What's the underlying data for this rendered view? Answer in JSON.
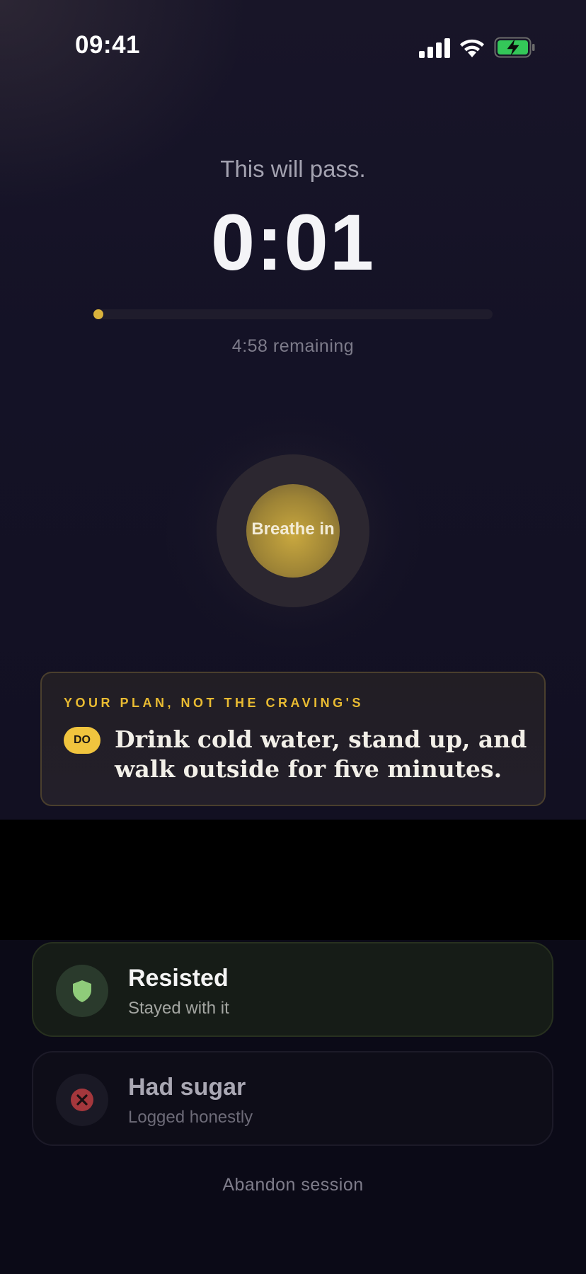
{
  "status_bar": {
    "time": "09:41",
    "icons": [
      "signal-icon",
      "wifi-icon",
      "battery-charging-icon"
    ],
    "battery_color": "#34c759"
  },
  "session": {
    "subtitle": "This will pass.",
    "timer": "0:01",
    "progress_fraction": 0.003,
    "remaining": "4:58 remaining",
    "accent_color": "#d9b23c"
  },
  "breathing": {
    "label": "Breathe in"
  },
  "plan": {
    "eyebrow": "YOUR PLAN, NOT THE CRAVING'S",
    "badge": "DO",
    "text": "Drink cold water, stand up, and walk outside for five minutes."
  },
  "outcomes": [
    {
      "title": "Resisted",
      "subtitle": "Stayed with it",
      "icon": "shield-icon",
      "color": "#8fcb7a"
    },
    {
      "title": "Had sugar",
      "subtitle": "Logged honestly",
      "icon": "x-circle-icon",
      "color": "#b6474a"
    }
  ],
  "abandon_label": "Abandon session"
}
